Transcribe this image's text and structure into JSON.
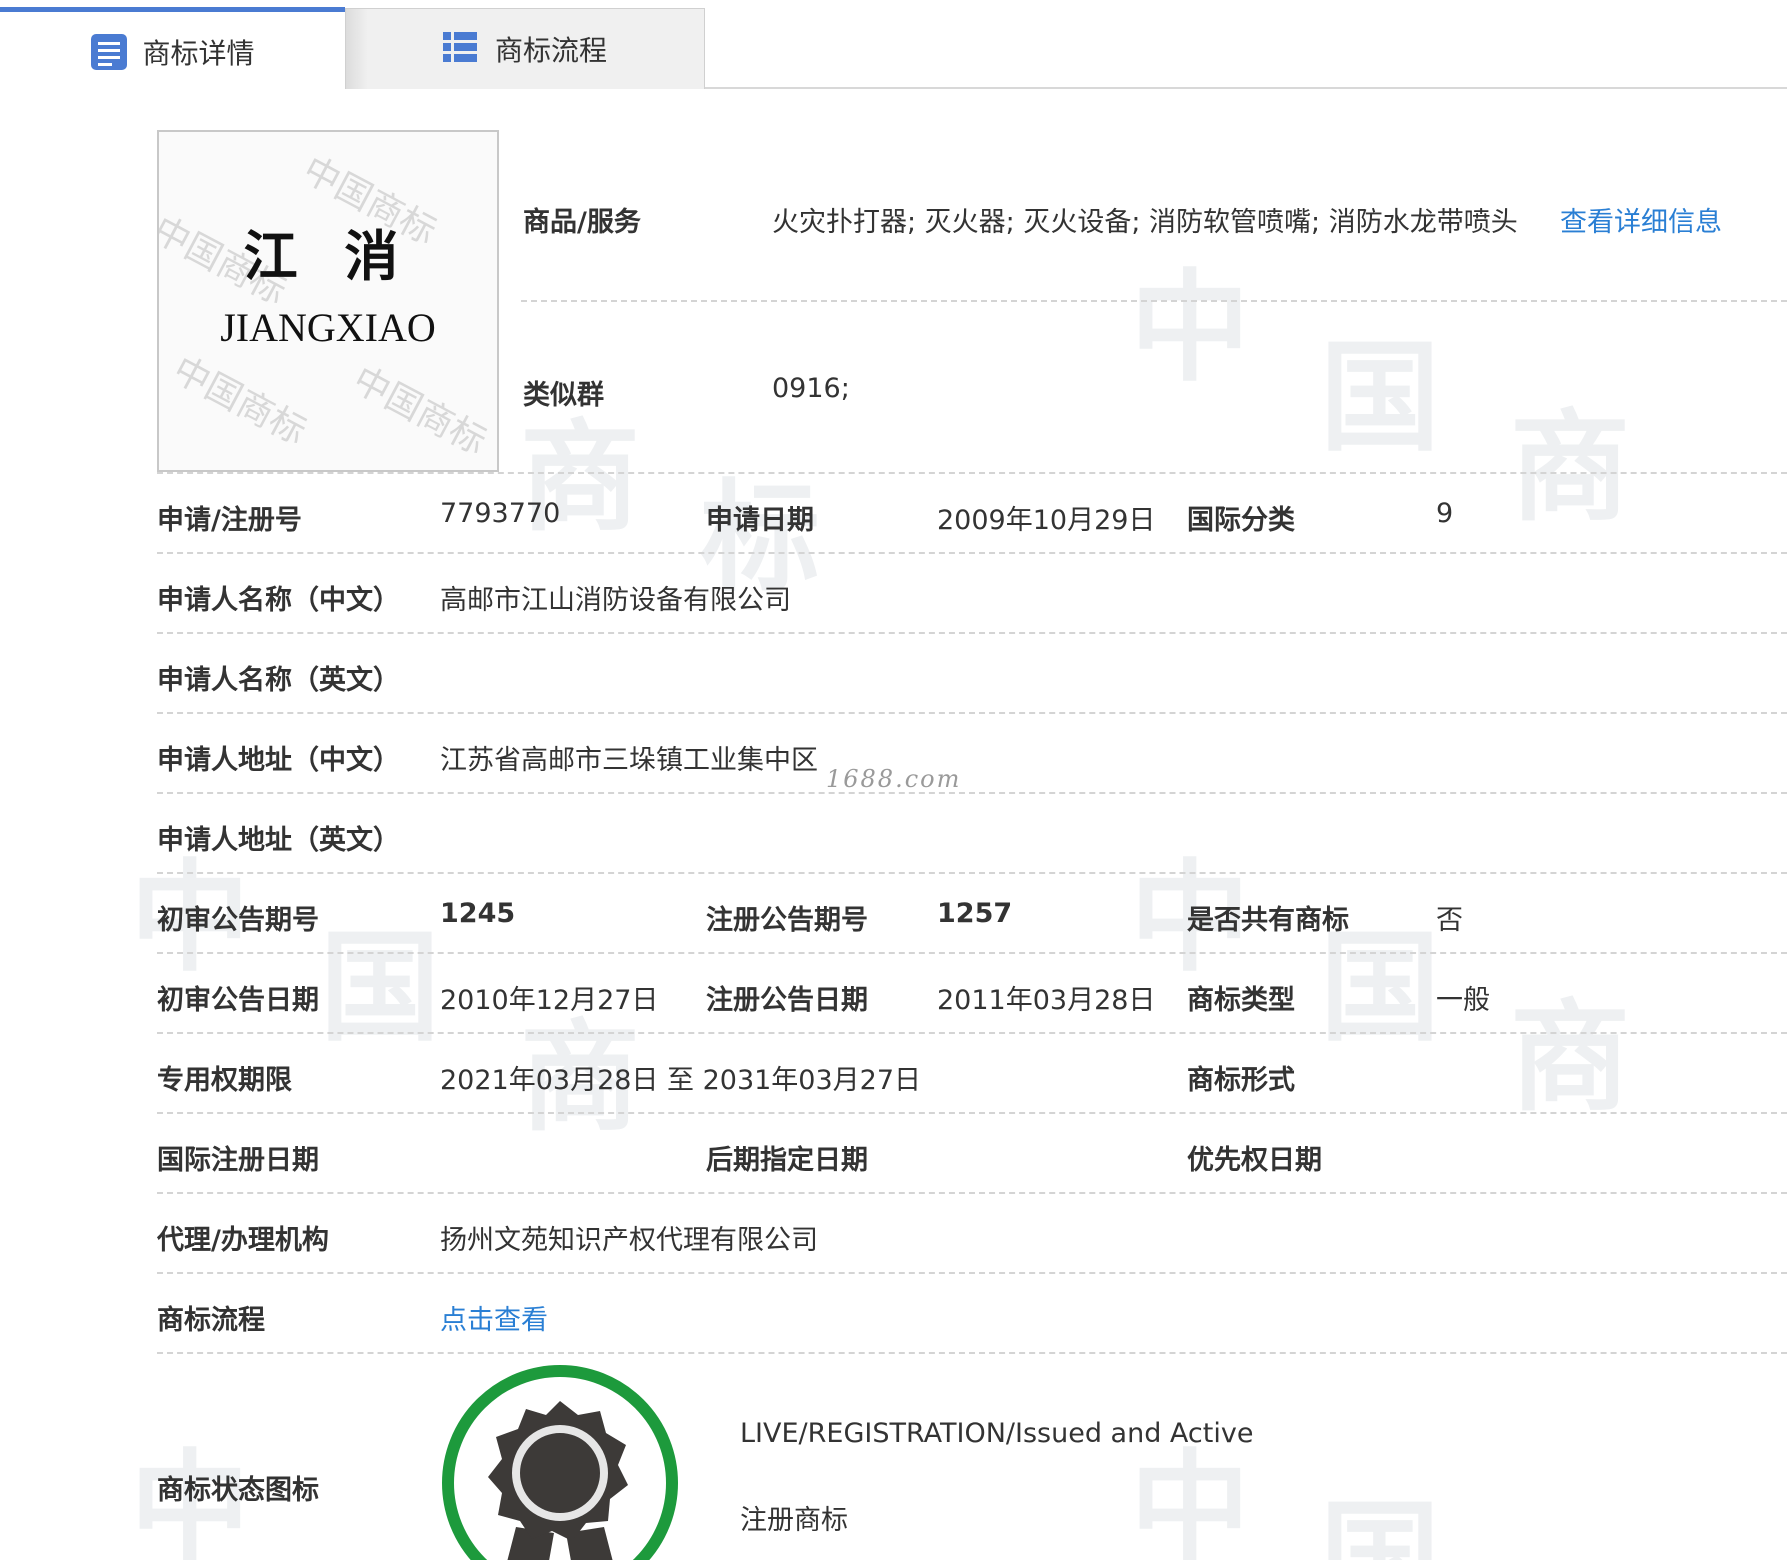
{
  "tabs": [
    {
      "label": "商标详情",
      "icon": "list-doc-icon",
      "active": true
    },
    {
      "label": "商标流程",
      "icon": "grid-list-icon",
      "active": false
    }
  ],
  "logo": {
    "text_cn": "江 消",
    "text_en": "JIANGXIAO"
  },
  "goods": {
    "label": "商品/服务",
    "value": "火灾扑打器; 灭火器; 灭火设备; 消防软管喷嘴; 消防水龙带喷头",
    "link": "查看详细信息"
  },
  "similar_group": {
    "label": "类似群",
    "value": "0916;"
  },
  "fields": {
    "reg_no_label": "申请/注册号",
    "reg_no": "7793770",
    "apply_date_label": "申请日期",
    "apply_date": "2009年10月29日",
    "intl_class_label": "国际分类",
    "intl_class": "9",
    "applicant_cn_label": "申请人名称（中文）",
    "applicant_cn": "高邮市江山消防设备有限公司",
    "applicant_en_label": "申请人名称（英文）",
    "applicant_en": "",
    "address_cn_label": "申请人地址（中文）",
    "address_cn": "江苏省高邮市三垛镇工业集中区",
    "address_en_label": "申请人地址（英文）",
    "address_en": "",
    "prelim_issue_label": "初审公告期号",
    "prelim_issue": "1245",
    "reg_issue_label": "注册公告期号",
    "reg_issue": "1257",
    "shared_label": "是否共有商标",
    "shared": "否",
    "prelim_date_label": "初审公告日期",
    "prelim_date": "2010年12月27日",
    "reg_date_label": "注册公告日期",
    "reg_date": "2011年03月28日",
    "type_label": "商标类型",
    "type": "一般",
    "exclusive_label": "专用权期限",
    "exclusive": "2021年03月28日 至 2031年03月27日",
    "form_label": "商标形式",
    "form": "",
    "intl_reg_date_label": "国际注册日期",
    "intl_reg_date": "",
    "later_date_label": "后期指定日期",
    "later_date": "",
    "priority_date_label": "优先权日期",
    "priority_date": "",
    "agent_label": "代理/办理机构",
    "agent": "扬州文苑知识产权代理有限公司",
    "process_label": "商标流程",
    "process_link": "点击查看",
    "status_icon_label": "商标状态图标",
    "status_en": "LIVE/REGISTRATION/Issued and Active",
    "status_cn": "注册商标"
  },
  "site_watermark": "1688.com",
  "colors": {
    "tab_accent": "#4a7bd2",
    "link": "#2a7fd4",
    "badge_ring": "#1d9a3c",
    "badge_medal": "#3d3a38"
  }
}
